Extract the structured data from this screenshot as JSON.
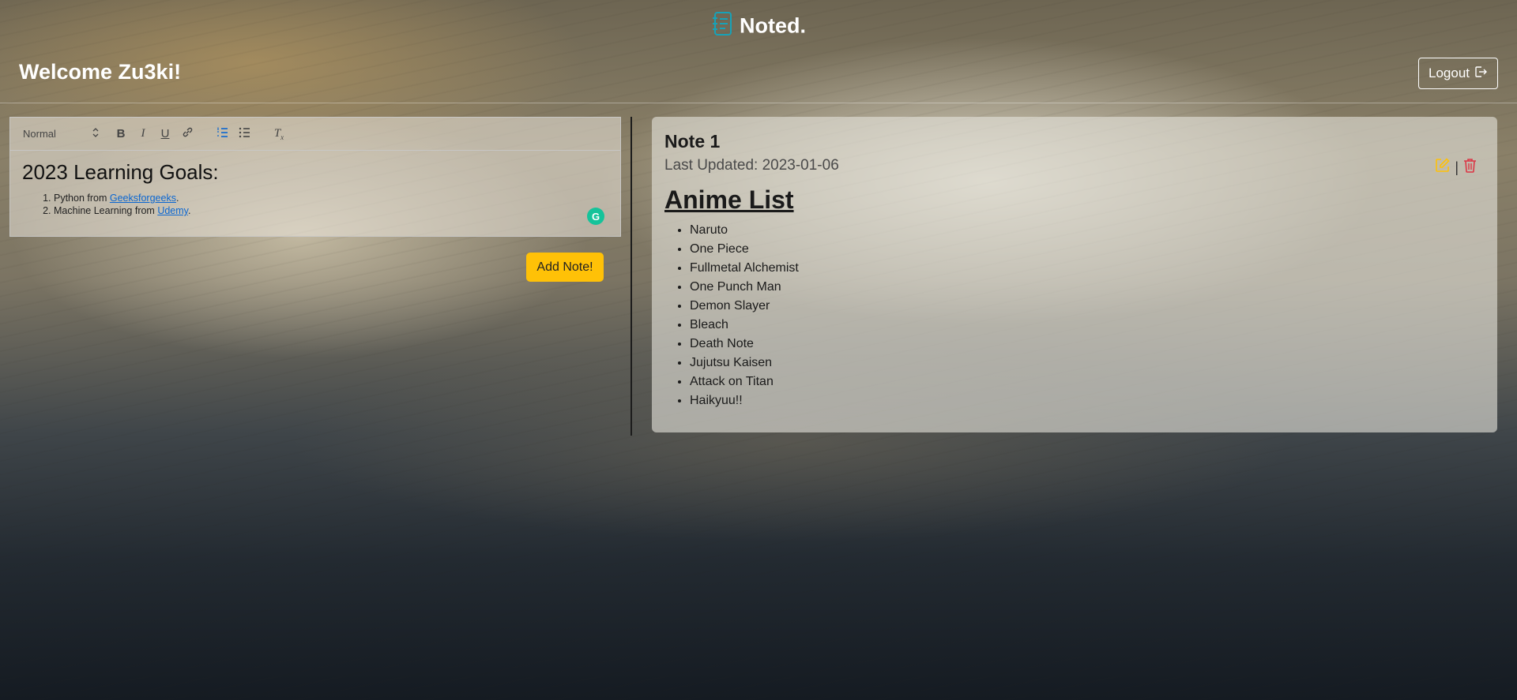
{
  "app": {
    "name": "Noted."
  },
  "header": {
    "welcome": "Welcome Zu3ki!",
    "logout_label": "Logout"
  },
  "editor": {
    "format_select": "Normal",
    "heading": "2023 Learning Goals:",
    "items": [
      {
        "prefix": "Python from ",
        "link": "Geeksforgeeks",
        "suffix": "."
      },
      {
        "prefix": "Machine Learning from ",
        "link": "Udemy",
        "suffix": "."
      }
    ],
    "add_label": "Add Note!"
  },
  "note": {
    "title": "Note 1",
    "last_updated": "Last Updated: 2023-01-06",
    "heading": "Anime List",
    "items": [
      "Naruto",
      "One Piece",
      "Fullmetal Alchemist",
      "One Punch Man",
      "Demon Slayer",
      "Bleach",
      "Death Note",
      "Jujutsu Kaisen",
      "Attack on Titan",
      "Haikyuu!!"
    ],
    "separator": "|"
  },
  "colors": {
    "brand_icon": "#17a2b8",
    "add_button": "#ffc107",
    "edit_icon": "#ffc107",
    "delete_icon": "#dc3545",
    "link": "#0a66d1"
  },
  "icons": [
    "journal-icon",
    "logout-icon",
    "bold-icon",
    "italic-icon",
    "underline-icon",
    "link-icon",
    "ordered-list-icon",
    "bullet-list-icon",
    "clear-format-icon",
    "grammarly-icon",
    "edit-icon",
    "trash-icon"
  ]
}
